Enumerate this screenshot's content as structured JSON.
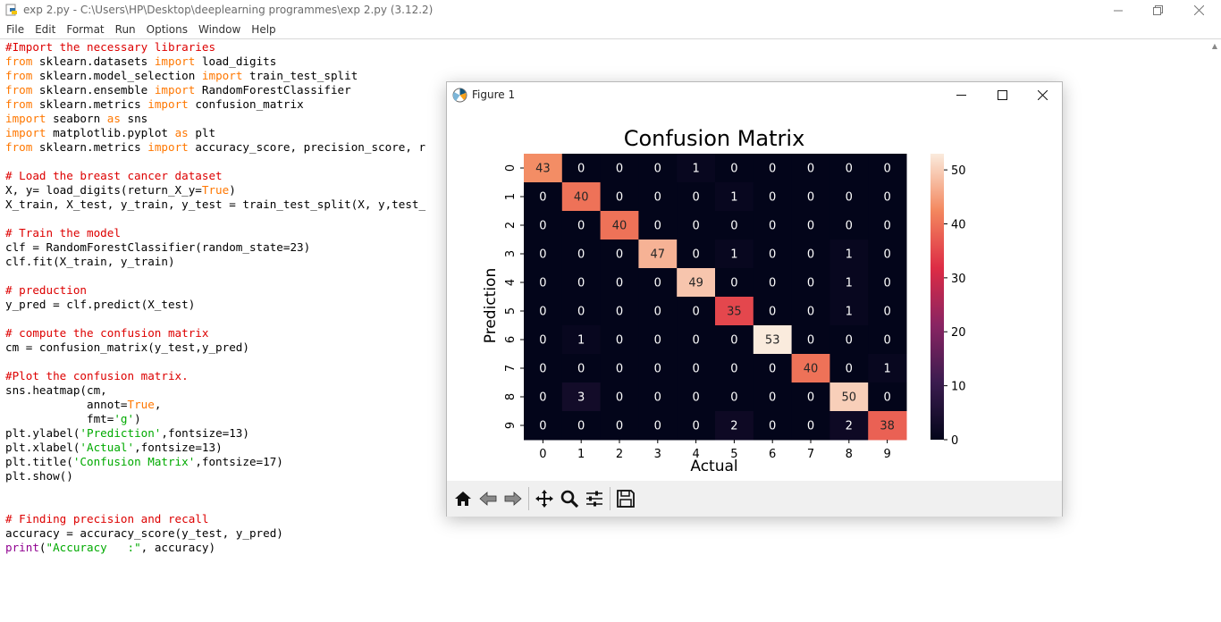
{
  "window": {
    "title": "exp 2.py - C:\\Users\\HP\\Desktop\\deeplearning programmes\\exp 2.py (3.12.2)"
  },
  "menu": [
    "File",
    "Edit",
    "Format",
    "Run",
    "Options",
    "Window",
    "Help"
  ],
  "code_lines": [
    [
      [
        "comment",
        "#Import the necessary libraries"
      ]
    ],
    [
      [
        "kw",
        "from"
      ],
      [
        "plain",
        " sklearn.datasets "
      ],
      [
        "kw",
        "import"
      ],
      [
        "plain",
        " load_digits"
      ]
    ],
    [
      [
        "kw",
        "from"
      ],
      [
        "plain",
        " sklearn.model_selection "
      ],
      [
        "kw",
        "import"
      ],
      [
        "plain",
        " train_test_split"
      ]
    ],
    [
      [
        "kw",
        "from"
      ],
      [
        "plain",
        " sklearn.ensemble "
      ],
      [
        "kw",
        "import"
      ],
      [
        "plain",
        " RandomForestClassifier"
      ]
    ],
    [
      [
        "kw",
        "from"
      ],
      [
        "plain",
        " sklearn.metrics "
      ],
      [
        "kw",
        "import"
      ],
      [
        "plain",
        " confusion_matrix"
      ]
    ],
    [
      [
        "kw",
        "import"
      ],
      [
        "plain",
        " seaborn "
      ],
      [
        "kw",
        "as"
      ],
      [
        "plain",
        " sns"
      ]
    ],
    [
      [
        "kw",
        "import"
      ],
      [
        "plain",
        " matplotlib.pyplot "
      ],
      [
        "kw",
        "as"
      ],
      [
        "plain",
        " plt"
      ]
    ],
    [
      [
        "kw",
        "from"
      ],
      [
        "plain",
        " sklearn.metrics "
      ],
      [
        "kw",
        "import"
      ],
      [
        "plain",
        " accuracy_score, precision_score, r"
      ]
    ],
    [],
    [
      [
        "comment",
        "# Load the breast cancer dataset"
      ]
    ],
    [
      [
        "plain",
        "X, y= load_digits(return_X_y="
      ],
      [
        "kw",
        "True"
      ],
      [
        "plain",
        ")"
      ]
    ],
    [
      [
        "plain",
        "X_train, X_test, y_train, y_test = train_test_split(X, y,test_"
      ]
    ],
    [],
    [
      [
        "comment",
        "# Train the model"
      ]
    ],
    [
      [
        "plain",
        "clf = RandomForestClassifier(random_state=23)"
      ]
    ],
    [
      [
        "plain",
        "clf.fit(X_train, y_train)"
      ]
    ],
    [],
    [
      [
        "comment",
        "# preduction"
      ]
    ],
    [
      [
        "plain",
        "y_pred = clf.predict(X_test)"
      ]
    ],
    [],
    [
      [
        "comment",
        "# compute the confusion matrix"
      ]
    ],
    [
      [
        "plain",
        "cm = confusion_matrix(y_test,y_pred)"
      ]
    ],
    [],
    [
      [
        "comment",
        "#Plot the confusion matrix."
      ]
    ],
    [
      [
        "plain",
        "sns.heatmap(cm,"
      ]
    ],
    [
      [
        "plain",
        "            annot="
      ],
      [
        "kw",
        "True"
      ],
      [
        "plain",
        ","
      ]
    ],
    [
      [
        "plain",
        "            fmt="
      ],
      [
        "str",
        "'g'"
      ],
      [
        "plain",
        ")"
      ]
    ],
    [
      [
        "plain",
        "plt.ylabel("
      ],
      [
        "str",
        "'Prediction'"
      ],
      [
        "plain",
        ",fontsize=13)"
      ]
    ],
    [
      [
        "plain",
        "plt.xlabel("
      ],
      [
        "str",
        "'Actual'"
      ],
      [
        "plain",
        ",fontsize=13)"
      ]
    ],
    [
      [
        "plain",
        "plt.title("
      ],
      [
        "str",
        "'Confusion Matrix'"
      ],
      [
        "plain",
        ",fontsize=17)"
      ]
    ],
    [
      [
        "plain",
        "plt.show()"
      ]
    ],
    [],
    [],
    [
      [
        "comment",
        "# Finding precision and recall"
      ]
    ],
    [
      [
        "plain",
        "accuracy = accuracy_score(y_test, y_pred)"
      ]
    ],
    [
      [
        "builtin",
        "print"
      ],
      [
        "plain",
        "("
      ],
      [
        "str",
        "\"Accuracy   :\""
      ],
      [
        "plain",
        ", accuracy)"
      ]
    ]
  ],
  "figure": {
    "title": "Figure 1",
    "toolbar": [
      "home-icon",
      "back-icon",
      "forward-icon",
      "pan-icon",
      "zoom-icon",
      "configure-icon",
      "save-icon"
    ]
  },
  "chart_data": {
    "type": "heatmap",
    "title": "Confusion Matrix",
    "xlabel": "Actual",
    "ylabel": "Prediction",
    "x_ticks": [
      "0",
      "1",
      "2",
      "3",
      "4",
      "5",
      "6",
      "7",
      "8",
      "9"
    ],
    "y_ticks": [
      "0",
      "1",
      "2",
      "3",
      "4",
      "5",
      "6",
      "7",
      "8",
      "9"
    ],
    "matrix": [
      [
        43,
        0,
        0,
        0,
        1,
        0,
        0,
        0,
        0,
        0
      ],
      [
        0,
        40,
        0,
        0,
        0,
        1,
        0,
        0,
        0,
        0
      ],
      [
        0,
        0,
        40,
        0,
        0,
        0,
        0,
        0,
        0,
        0
      ],
      [
        0,
        0,
        0,
        47,
        0,
        1,
        0,
        0,
        1,
        0
      ],
      [
        0,
        0,
        0,
        0,
        49,
        0,
        0,
        0,
        1,
        0
      ],
      [
        0,
        0,
        0,
        0,
        0,
        35,
        0,
        0,
        1,
        0
      ],
      [
        0,
        1,
        0,
        0,
        0,
        0,
        53,
        0,
        0,
        0
      ],
      [
        0,
        0,
        0,
        0,
        0,
        0,
        0,
        40,
        0,
        1
      ],
      [
        0,
        3,
        0,
        0,
        0,
        0,
        0,
        0,
        50,
        0
      ],
      [
        0,
        0,
        0,
        0,
        0,
        2,
        0,
        0,
        2,
        38
      ]
    ],
    "colorbar": {
      "ticks": [
        0,
        10,
        20,
        30,
        40,
        50
      ],
      "range": [
        0,
        53
      ],
      "colormap": "rocket"
    }
  }
}
